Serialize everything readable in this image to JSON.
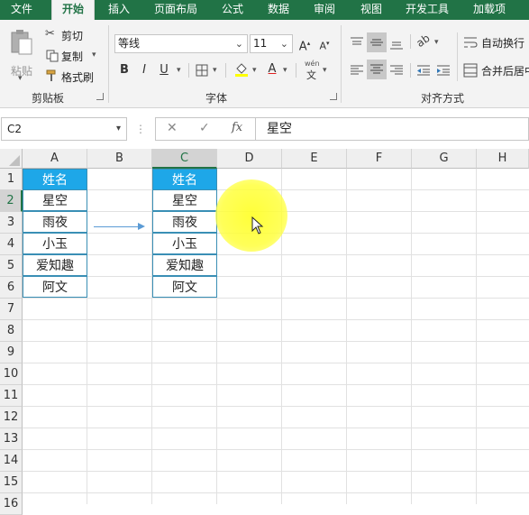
{
  "ribbon": {
    "tabs": [
      "文件",
      "开始",
      "插入",
      "页面布局",
      "公式",
      "数据",
      "审阅",
      "视图",
      "开发工具",
      "加载项"
    ],
    "active_tab": "开始",
    "clipboard": {
      "paste_label": "粘贴",
      "cut_label": "剪切",
      "copy_label": "复制",
      "format_painter_label": "格式刷",
      "group_label": "剪贴板"
    },
    "font": {
      "font_name": "等线",
      "font_size": "11",
      "bold": "B",
      "italic": "I",
      "underline": "U",
      "group_label": "字体",
      "phonetic_label": "wén"
    },
    "alignment": {
      "wrap_text_label": "自动换行",
      "merge_center_label": "合并后居中",
      "group_label": "对齐方式"
    },
    "accent_color": "#217346"
  },
  "formula_bar": {
    "name_box": "C2",
    "cancel_icon": "✕",
    "enter_icon": "✓",
    "fx_label": "fx",
    "formula": "星空"
  },
  "sheet": {
    "columns": [
      "A",
      "B",
      "C",
      "D",
      "E",
      "F",
      "G",
      "H"
    ],
    "rows": [
      "1",
      "2",
      "3",
      "4",
      "5",
      "6",
      "7",
      "8",
      "9",
      "10",
      "11",
      "12",
      "13",
      "14",
      "15",
      "16"
    ],
    "selected_column": "C",
    "selected_row": "2",
    "source_table": {
      "header": "姓名",
      "values": [
        "星空",
        "雨夜",
        "小玉",
        "爱知趣",
        "阿文"
      ]
    },
    "target_table": {
      "header": "姓名",
      "values": [
        "星空",
        "雨夜",
        "小玉",
        "爱知趣",
        "阿文"
      ]
    },
    "header_fill": "#1ea7e8",
    "border_color": "#3a8fb5"
  }
}
